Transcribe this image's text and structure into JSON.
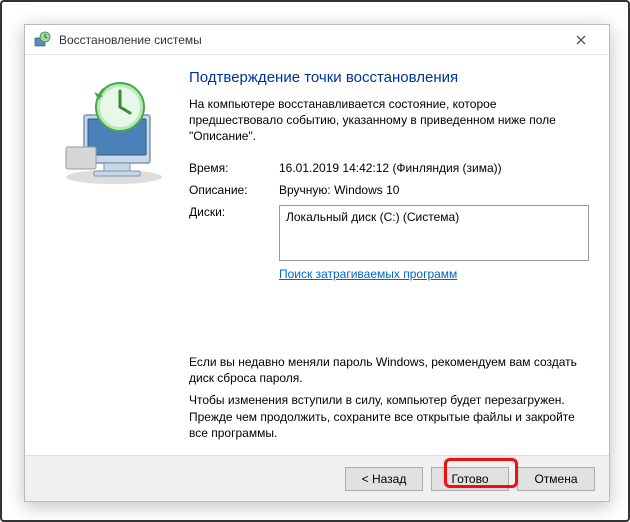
{
  "window": {
    "title": "Восстановление системы"
  },
  "main": {
    "heading": "Подтверждение точки восстановления",
    "description": "На компьютере восстанавливается состояние, которое предшествовало событию, указанному в приведенном ниже поле \"Описание\".",
    "time_label": "Время:",
    "time_value": "16.01.2019 14:42:12 (Финляндия (зима))",
    "desc_label": "Описание:",
    "desc_value": "Вручную: Windows 10",
    "drives_label": "Диски:",
    "drives_value": "Локальный диск (C:) (Система)",
    "scan_link": "Поиск затрагиваемых программ",
    "warn1": "Если вы недавно меняли пароль Windows, рекомендуем вам создать диск сброса пароля.",
    "warn2": "Чтобы изменения вступили в силу, компьютер будет перезагружен. Прежде чем продолжить, сохраните все открытые файлы и закройте все программы."
  },
  "buttons": {
    "back": "< Назад",
    "finish": "Готово",
    "cancel": "Отмена"
  }
}
